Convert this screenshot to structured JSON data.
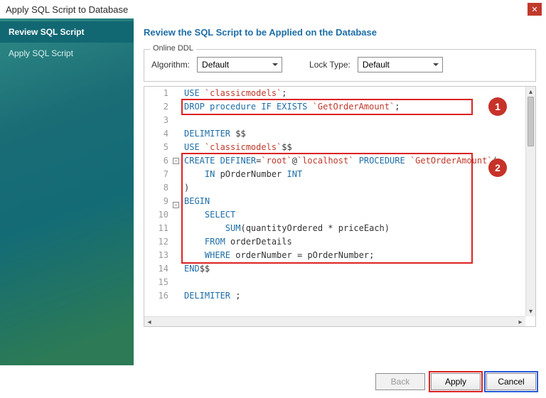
{
  "window": {
    "title": "Apply SQL Script to Database"
  },
  "sidebar": {
    "items": [
      {
        "label": "Review SQL Script",
        "active": true
      },
      {
        "label": "Apply SQL Script",
        "active": false
      }
    ]
  },
  "main": {
    "heading": "Review the SQL Script to be Applied on the Database",
    "ddl": {
      "legend": "Online DDL",
      "algorithm_label": "Algorithm:",
      "algorithm_value": "Default",
      "locktype_label": "Lock Type:",
      "locktype_value": "Default"
    }
  },
  "code_lines": [
    {
      "n": 1,
      "fold": "",
      "tokens": [
        [
          "kw",
          "USE "
        ],
        [
          "str",
          "`classicmodels`"
        ],
        [
          "pl",
          ";"
        ]
      ]
    },
    {
      "n": 2,
      "fold": "",
      "tokens": [
        [
          "kw",
          "DROP procedure IF EXISTS "
        ],
        [
          "str",
          "`GetOrderAmount`"
        ],
        [
          "pl",
          ";"
        ]
      ]
    },
    {
      "n": 3,
      "fold": "",
      "tokens": []
    },
    {
      "n": 4,
      "fold": "",
      "tokens": [
        [
          "kw",
          "DELIMITER"
        ],
        [
          "pl",
          " $$"
        ]
      ]
    },
    {
      "n": 5,
      "fold": "",
      "tokens": [
        [
          "kw",
          "USE "
        ],
        [
          "str",
          "`classicmodels`"
        ],
        [
          "pl",
          "$$"
        ]
      ]
    },
    {
      "n": 6,
      "fold": "-",
      "tokens": [
        [
          "kw",
          "CREATE DEFINER"
        ],
        [
          "pl",
          "="
        ],
        [
          "str",
          "`root`"
        ],
        [
          "pl",
          "@"
        ],
        [
          "str",
          "`localhost`"
        ],
        [
          "kw",
          " PROCEDURE "
        ],
        [
          "str",
          "`GetOrderAmount`"
        ],
        [
          "pl",
          "("
        ]
      ]
    },
    {
      "n": 7,
      "fold": "",
      "tokens": [
        [
          "pl",
          "    "
        ],
        [
          "kw",
          "IN"
        ],
        [
          "pl",
          " pOrderNumber "
        ],
        [
          "kw",
          "INT"
        ]
      ]
    },
    {
      "n": 8,
      "fold": "",
      "tokens": [
        [
          "pl",
          ")"
        ]
      ]
    },
    {
      "n": 9,
      "fold": "-",
      "tokens": [
        [
          "kw",
          "BEGIN"
        ]
      ]
    },
    {
      "n": 10,
      "fold": "",
      "tokens": [
        [
          "pl",
          "    "
        ],
        [
          "kw",
          "SELECT"
        ]
      ]
    },
    {
      "n": 11,
      "fold": "",
      "tokens": [
        [
          "pl",
          "        "
        ],
        [
          "kw",
          "SUM"
        ],
        [
          "pl",
          "(quantityOrdered * priceEach)"
        ]
      ]
    },
    {
      "n": 12,
      "fold": "",
      "tokens": [
        [
          "pl",
          "    "
        ],
        [
          "kw",
          "FROM"
        ],
        [
          "pl",
          " orderDetails"
        ]
      ]
    },
    {
      "n": 13,
      "fold": "",
      "tokens": [
        [
          "pl",
          "    "
        ],
        [
          "kw",
          "WHERE"
        ],
        [
          "pl",
          " orderNumber = pOrderNumber;"
        ]
      ]
    },
    {
      "n": 14,
      "fold": "",
      "tokens": [
        [
          "kw",
          "END"
        ],
        [
          "pl",
          "$$"
        ]
      ]
    },
    {
      "n": 15,
      "fold": "",
      "tokens": []
    },
    {
      "n": 16,
      "fold": "",
      "tokens": [
        [
          "kw",
          "DELIMITER"
        ],
        [
          "pl",
          " ;"
        ]
      ]
    }
  ],
  "annotations": [
    {
      "label": "1",
      "line_from": 2,
      "line_to": 2
    },
    {
      "label": "2",
      "line_from": 6,
      "line_to": 13
    }
  ],
  "footer": {
    "back": "Back",
    "apply": "Apply",
    "cancel": "Cancel"
  }
}
